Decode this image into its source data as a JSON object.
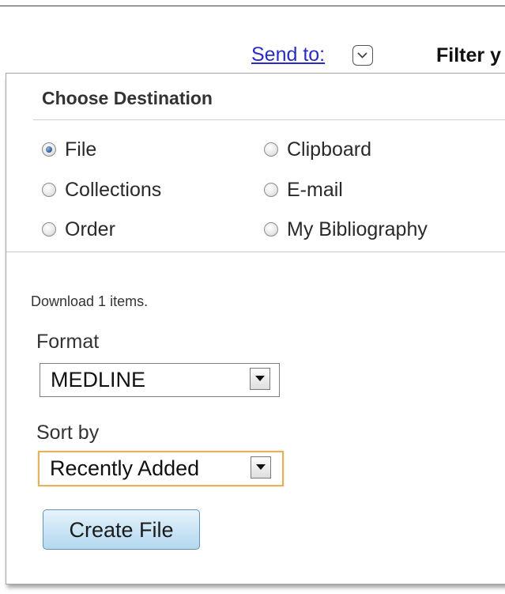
{
  "send_to": {
    "link_label": "Send to:",
    "toggle_icon": "chevron-down-icon"
  },
  "filter": {
    "label": "Filter y"
  },
  "destination": {
    "heading": "Choose Destination",
    "selected": "File",
    "options": [
      {
        "label": "File",
        "checked": true
      },
      {
        "label": "Clipboard",
        "checked": false
      },
      {
        "label": "Collections",
        "checked": false
      },
      {
        "label": "E-mail",
        "checked": false
      },
      {
        "label": "Order",
        "checked": false
      },
      {
        "label": "My Bibliography",
        "checked": false
      }
    ]
  },
  "download": {
    "text": "Download 1 items.",
    "format_label": "Format",
    "format_value": "MEDLINE",
    "sort_label": "Sort by",
    "sort_value": "Recently Added",
    "create_button_label": "Create File"
  },
  "colors": {
    "link": "#2a2cc2",
    "button_bg": "#cbe5f5",
    "button_border": "#5e94b8",
    "focus_border": "#e1b262"
  }
}
